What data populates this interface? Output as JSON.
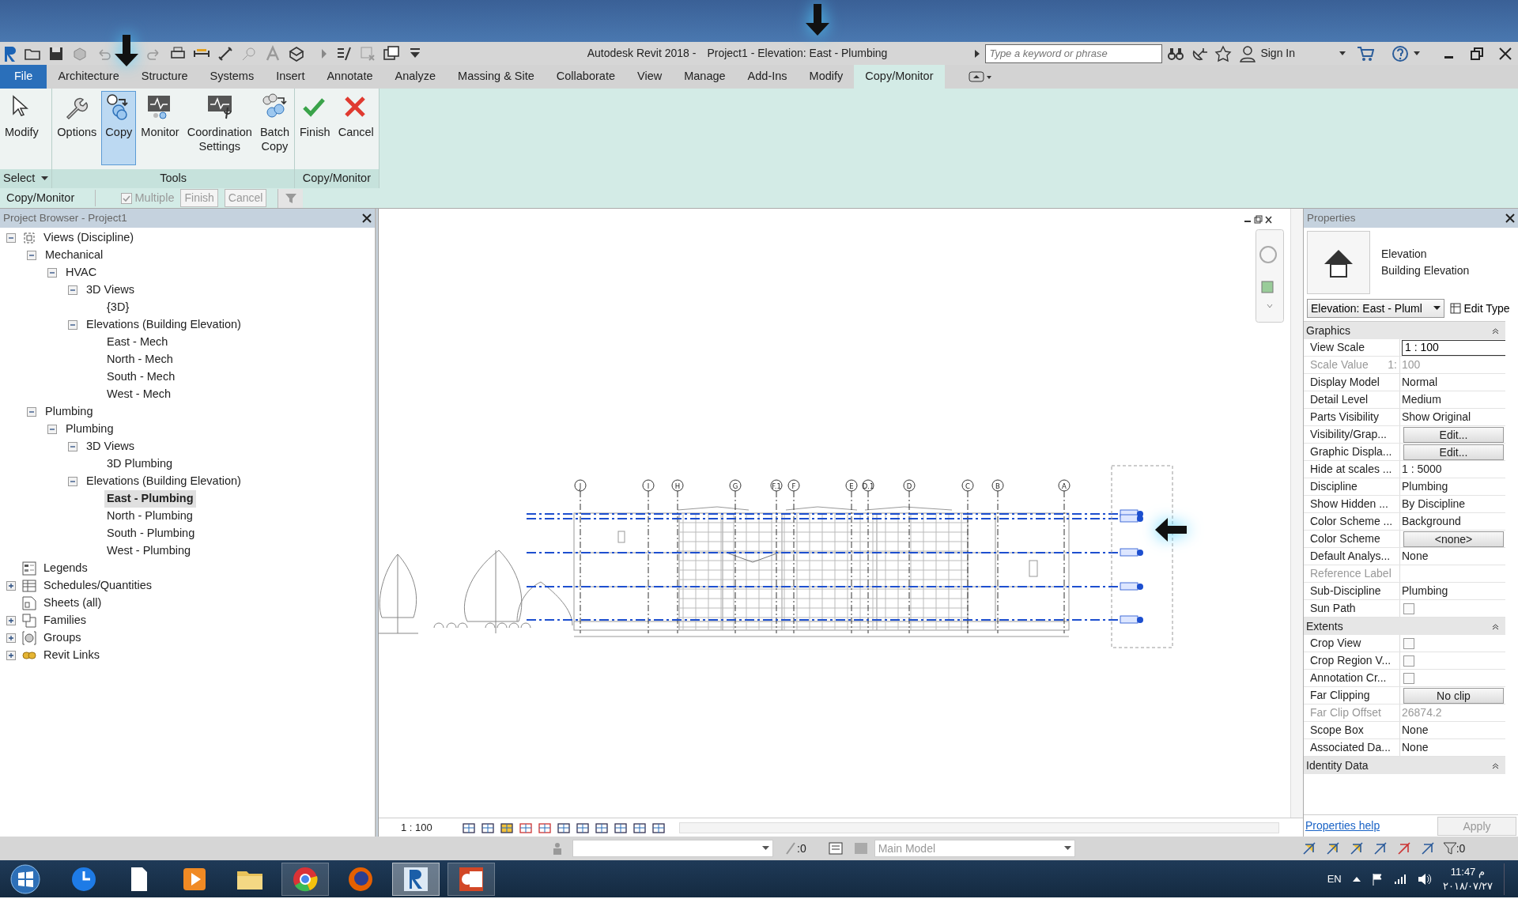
{
  "title_bar": {
    "app": "Autodesk Revit 2018 -",
    "document": "Project1 - Elevation: East - Plumbing",
    "search": {
      "placeholder": "Type a keyword or phrase"
    },
    "sign_in": "Sign In"
  },
  "file_tab": "File",
  "ribbon_tabs": [
    {
      "label": "Architecture",
      "selected": false
    },
    {
      "label": "Structure",
      "selected": false
    },
    {
      "label": "Systems",
      "selected": false
    },
    {
      "label": "Insert",
      "selected": false
    },
    {
      "label": "Annotate",
      "selected": false
    },
    {
      "label": "Analyze",
      "selected": false
    },
    {
      "label": "Massing & Site",
      "selected": false
    },
    {
      "label": "Collaborate",
      "selected": false
    },
    {
      "label": "View",
      "selected": false
    },
    {
      "label": "Manage",
      "selected": false
    },
    {
      "label": "Add-Ins",
      "selected": false
    },
    {
      "label": "Modify",
      "selected": false
    },
    {
      "label": "Copy/Monitor",
      "selected": true
    }
  ],
  "ribbon_panels": [
    {
      "title": "Select",
      "dropdown": true,
      "tools": [
        {
          "label": "Modify",
          "selected": false
        }
      ]
    },
    {
      "title": "Tools",
      "dropdown": false,
      "tools": [
        {
          "label": "Options",
          "selected": false
        },
        {
          "label": "Copy",
          "selected": true
        },
        {
          "label": "Monitor",
          "selected": false
        },
        {
          "label": "Coordination Settings",
          "selected": false
        },
        {
          "label": "Batch Copy",
          "selected": false
        }
      ]
    },
    {
      "title": "Copy/Monitor",
      "dropdown": false,
      "tools": [
        {
          "label": "Finish",
          "selected": false
        },
        {
          "label": "Cancel",
          "selected": false
        }
      ]
    }
  ],
  "options_bar": {
    "label": "Copy/Monitor",
    "multiple": {
      "label": "Multiple",
      "checked": true,
      "disabled": true
    },
    "buttons": [
      {
        "label": "Finish",
        "disabled": true
      },
      {
        "label": "Cancel",
        "disabled": true
      }
    ]
  },
  "project_browser": {
    "title": "Project Browser - Project1",
    "tree": [
      {
        "label": "Views (Discipline)",
        "expanded": true,
        "selected": false,
        "children": [
          {
            "label": "Mechanical",
            "expanded": true,
            "selected": false,
            "children": [
              {
                "label": "HVAC",
                "expanded": true,
                "selected": false,
                "children": [
                  {
                    "label": "3D Views",
                    "expanded": true,
                    "selected": false,
                    "children": [
                      {
                        "label": "{3D}",
                        "selected": false
                      }
                    ]
                  },
                  {
                    "label": "Elevations (Building Elevation)",
                    "expanded": true,
                    "selected": false,
                    "children": [
                      {
                        "label": "East - Mech",
                        "selected": false
                      },
                      {
                        "label": "North - Mech",
                        "selected": false
                      },
                      {
                        "label": "South - Mech",
                        "selected": false
                      },
                      {
                        "label": "West - Mech",
                        "selected": false
                      }
                    ]
                  }
                ]
              }
            ]
          },
          {
            "label": "Plumbing",
            "expanded": true,
            "selected": false,
            "children": [
              {
                "label": "Plumbing",
                "expanded": true,
                "selected": false,
                "children": [
                  {
                    "label": "3D Views",
                    "expanded": true,
                    "selected": false,
                    "children": [
                      {
                        "label": "3D Plumbing",
                        "selected": false
                      }
                    ]
                  },
                  {
                    "label": "Elevations (Building Elevation)",
                    "expanded": true,
                    "selected": false,
                    "children": [
                      {
                        "label": "East - Plumbing",
                        "selected": true
                      },
                      {
                        "label": "North - Plumbing",
                        "selected": false
                      },
                      {
                        "label": "South - Plumbing",
                        "selected": false
                      },
                      {
                        "label": "West - Plumbing",
                        "selected": false
                      }
                    ]
                  }
                ]
              }
            ]
          }
        ]
      },
      {
        "label": "Legends",
        "selected": false
      },
      {
        "label": "Schedules/Quantities",
        "expanded": false,
        "selected": false
      },
      {
        "label": "Sheets (all)",
        "selected": false
      },
      {
        "label": "Families",
        "expanded": false,
        "selected": false
      },
      {
        "label": "Groups",
        "expanded": false,
        "selected": false
      },
      {
        "label": "Revit Links",
        "expanded": false,
        "selected": false
      }
    ]
  },
  "drawing": {
    "grid_labels": [
      "J",
      "I",
      "H",
      "G",
      "F.1",
      "F",
      "E",
      "D.1",
      "D",
      "C",
      "B",
      "A"
    ]
  },
  "view_bar": {
    "scale": "1 : 100"
  },
  "properties": {
    "title": "Properties",
    "type_name": "Elevation",
    "type_sub": "Building Elevation",
    "selector": "Elevation: East - Pluml",
    "edit_type": "Edit Type",
    "groups": [
      {
        "name": "Graphics",
        "rows": [
          {
            "label": "View Scale",
            "kind": "input",
            "value": "1 : 100",
            "disabled": false
          },
          {
            "label": "Scale Value",
            "prefix": "1:",
            "kind": "text",
            "value": "100",
            "disabled": true
          },
          {
            "label": "Display Model",
            "kind": "text",
            "value": "Normal",
            "disabled": false
          },
          {
            "label": "Detail Level",
            "kind": "text",
            "value": "Medium",
            "disabled": false
          },
          {
            "label": "Parts Visibility",
            "kind": "text",
            "value": "Show Original",
            "disabled": false
          },
          {
            "label": "Visibility/Grap...",
            "kind": "button",
            "value": "Edit...",
            "disabled": false
          },
          {
            "label": "Graphic Displa...",
            "kind": "button",
            "value": "Edit...",
            "disabled": false
          },
          {
            "label": "Hide at scales ...",
            "kind": "text",
            "value": " 1 : 5000",
            "disabled": false
          },
          {
            "label": "Discipline",
            "kind": "text",
            "value": "Plumbing",
            "disabled": false
          },
          {
            "label": "Show Hidden ...",
            "kind": "text",
            "value": "By Discipline",
            "disabled": false
          },
          {
            "label": "Color Scheme ...",
            "kind": "text",
            "value": "Background",
            "disabled": false
          },
          {
            "label": "Color Scheme",
            "kind": "button",
            "value": "<none>",
            "disabled": false
          },
          {
            "label": "Default Analys...",
            "kind": "text",
            "value": "None",
            "disabled": false
          },
          {
            "label": "Reference Label",
            "kind": "text",
            "disabled": true
          },
          {
            "label": "Sub-Discipline",
            "kind": "text",
            "value": "Plumbing",
            "disabled": false
          },
          {
            "label": "Sun Path",
            "kind": "checkbox",
            "checked": false,
            "disabled": false
          }
        ]
      },
      {
        "name": "Extents",
        "rows": [
          {
            "label": "Crop View",
            "kind": "checkbox",
            "checked": false,
            "disabled": false
          },
          {
            "label": "Crop Region V...",
            "kind": "checkbox",
            "checked": false,
            "disabled": false
          },
          {
            "label": "Annotation Cr...",
            "kind": "checkbox",
            "checked": false,
            "disabled": false
          },
          {
            "label": "Far Clipping",
            "kind": "button",
            "value": "No clip",
            "disabled": false
          },
          {
            "label": "Far Clip Offset",
            "kind": "text",
            "value": "26874.2",
            "disabled": true
          },
          {
            "label": "Scope Box",
            "kind": "text",
            "value": "None",
            "disabled": false
          },
          {
            "label": "Associated Da...",
            "kind": "text",
            "value": "None",
            "disabled": false
          }
        ]
      },
      {
        "name": "Identity Data"
      }
    ],
    "help": "Properties help",
    "apply": "Apply"
  },
  "status_bar": {
    "design_count": ":0",
    "model": "Main Model",
    "filter_count": ":0"
  },
  "taskbar": {
    "apps": [
      {
        "running": false,
        "selected": false
      },
      {
        "running": false,
        "selected": false
      },
      {
        "running": false,
        "selected": false
      },
      {
        "running": false,
        "selected": false
      },
      {
        "running": true,
        "selected": false
      },
      {
        "running": false,
        "selected": false
      },
      {
        "running": true,
        "selected": true
      },
      {
        "running": true,
        "selected": false
      }
    ],
    "language": "EN",
    "time": "11:47 م",
    "date": "٢٠١٨/٠٧/٢٧"
  }
}
